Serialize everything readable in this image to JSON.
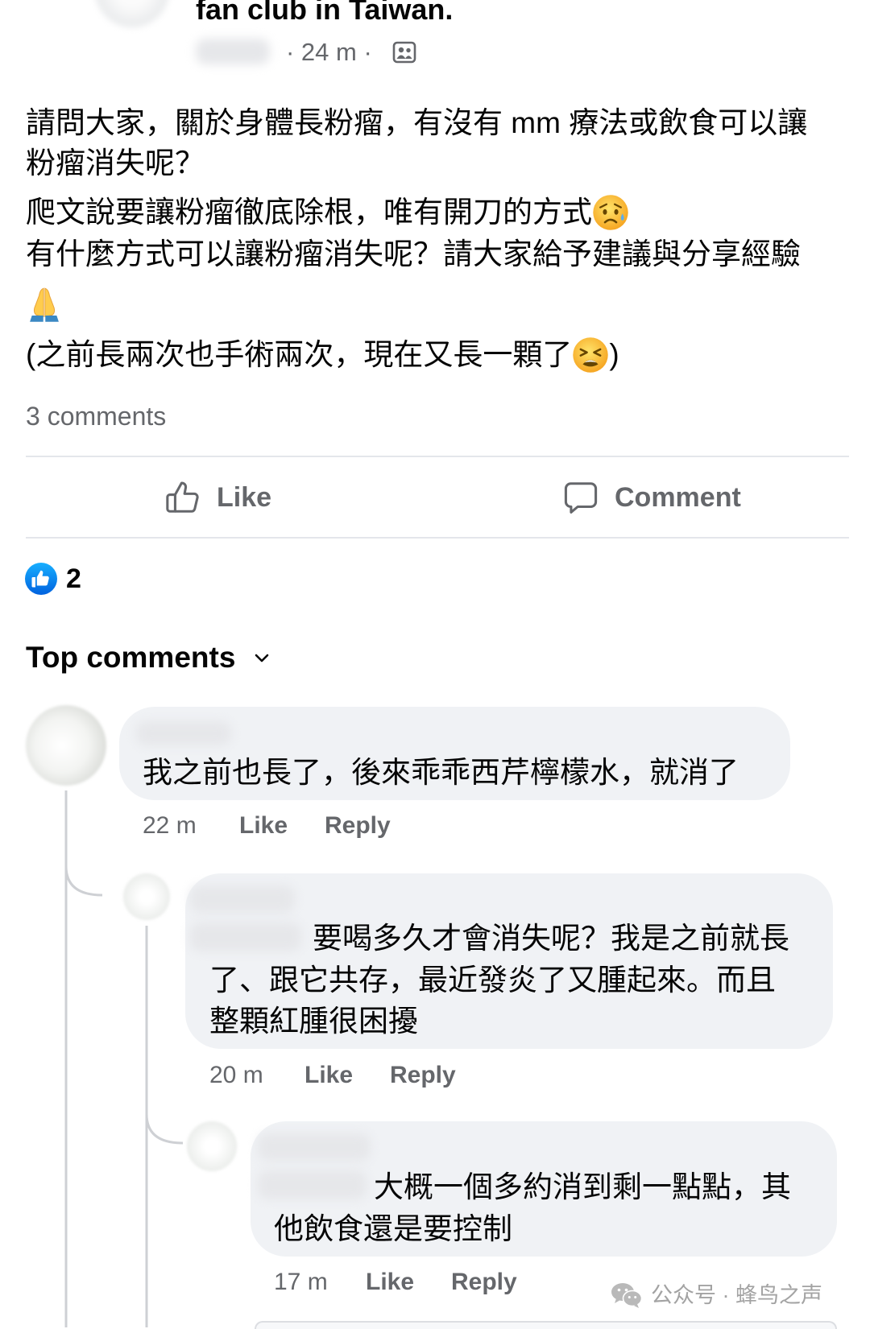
{
  "post": {
    "group_name": "fan club in Taiwan.",
    "time": "· 24 m ·",
    "audience_icon": "group-members-icon",
    "lines": [
      {
        "text": "請問大家，關於身體長粉瘤，有沒有 mm 療法或飲食可以讓"
      },
      {
        "text": "粉瘤消失呢？"
      },
      {
        "text": "爬文說要讓粉瘤徹底除根，唯有開刀的方式",
        "emoji": "sad-but-relieved-face-emoji"
      },
      {
        "text": "有什麼方式可以讓粉瘤消失呢？請大家給予建議與分享經驗"
      },
      {
        "emoji": "folded-hands-emoji"
      },
      {
        "text": "(之前長兩次也手術兩次，現在又長一顆了",
        "emoji": "tired-face-emoji",
        "text_after": ")"
      }
    ],
    "comment_count": "3 comments"
  },
  "actions": {
    "like": {
      "label": "Like",
      "icon": "thumbs-up-outline-icon"
    },
    "comment": {
      "label": "Comment",
      "icon": "comment-bubble-icon"
    }
  },
  "reactions": {
    "icon": "like-reaction-icon",
    "count": "2"
  },
  "comments_header": {
    "label": "Top comments",
    "icon": "chevron-down-icon"
  },
  "comments": [
    {
      "lines": [
        "我之前也長了，後來乖乖西芹檸檬水，就消了"
      ],
      "time": "22 m",
      "like": "Like",
      "reply": "Reply"
    },
    {
      "lines": [
        "要喝多久才會消失呢？我是之前就長",
        "了、跟它共存，最近發炎了又腫起來。而且",
        "整顆紅腫很困擾"
      ],
      "time": "20 m",
      "like": "Like",
      "reply": "Reply"
    },
    {
      "lines": [
        "大概一個多約消到剩一點點，其",
        "他飲食還是要控制"
      ],
      "time": "17 m",
      "like": "Like",
      "reply": "Reply"
    }
  ],
  "watermark": {
    "icon": "wechat-icon",
    "text": "公众号 · 蜂鸟之声"
  },
  "colors": {
    "text": "#050505",
    "secondary": "#65676b",
    "comment_bubble": "#f0f2f5",
    "like_blue": "#0866ff"
  }
}
